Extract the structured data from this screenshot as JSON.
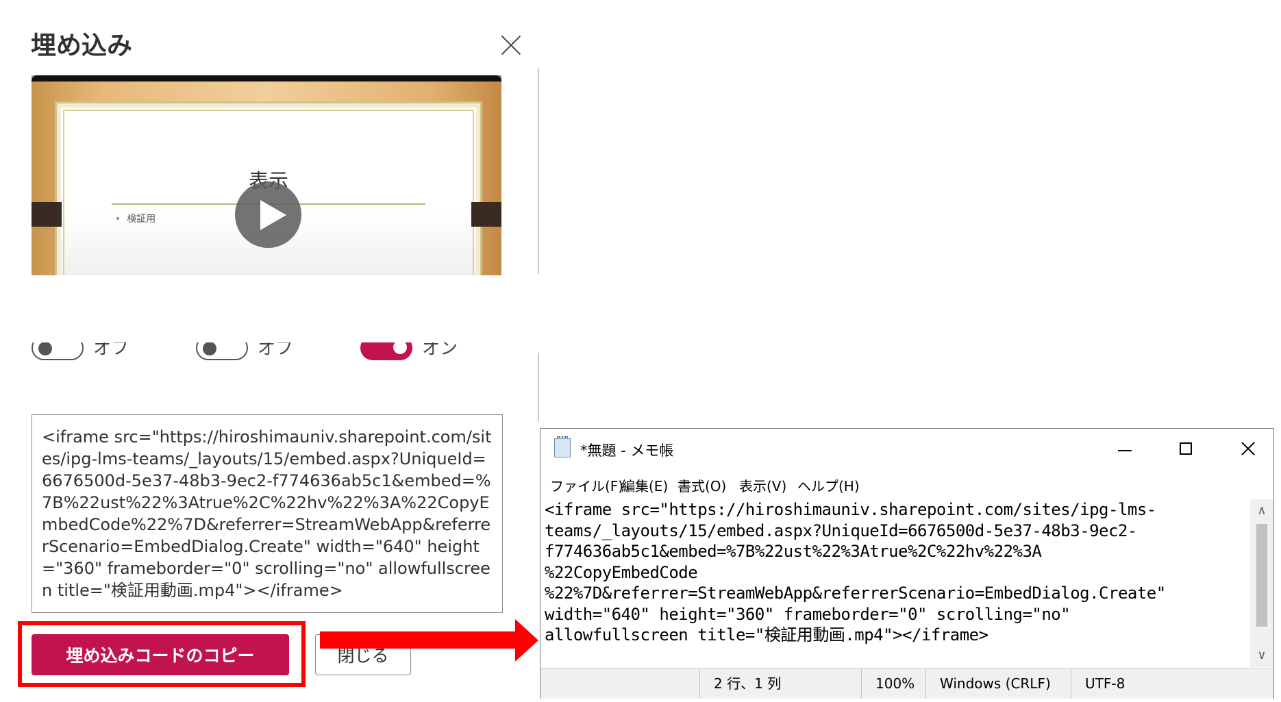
{
  "dialog": {
    "title": "埋め込み",
    "video": {
      "slide_title": "表示",
      "slide_bullet": "検証用"
    },
    "toggles": [
      {
        "state": "off",
        "label": "オフ"
      },
      {
        "state": "off",
        "label": "オフ"
      },
      {
        "state": "on",
        "label": "オン"
      }
    ],
    "embed_code": "<iframe src=\"https://hiroshimauniv.sharepoint.com/sites/ipg-lms-teams/_layouts/15/embed.aspx?UniqueId=6676500d-5e37-48b3-9ec2-f774636ab5c1&embed=%7B%22ust%22%3Atrue%2C%22hv%22%3A%22CopyEmbedCode%22%7D&referrer=StreamWebApp&referrerScenario=EmbedDialog.Create\" width=\"640\" height=\"360\" frameborder=\"0\" scrolling=\"no\" allowfullscreen title=\"検証用動画.mp4\"></iframe>",
    "copy_button": "埋め込みコードのコピー",
    "close_button": "閉じる",
    "accent_color": "#c2134d",
    "highlight_color": "#ff0000"
  },
  "notepad": {
    "title": "*無題 - メモ帳",
    "menu": [
      "ファイル(F)",
      "編集(E)",
      "書式(O)",
      "表示(V)",
      "ヘルプ(H)"
    ],
    "content": "<iframe src=\"https://hiroshimauniv.sharepoint.com/sites/ipg-lms-\nteams/_layouts/15/embed.aspx?UniqueId=6676500d-5e37-48b3-9ec2-\nf774636ab5c1&embed=%7B%22ust%22%3Atrue%2C%22hv%22%3A\n%22CopyEmbedCode\n%22%7D&referrer=StreamWebApp&referrerScenario=EmbedDialog.Create\"\nwidth=\"640\" height=\"360\" frameborder=\"0\" scrolling=\"no\"\nallowfullscreen title=\"検証用動画.mp4\"></iframe>",
    "status": {
      "position": "2 行、1 列",
      "zoom": "100%",
      "line_ending": "Windows (CRLF)",
      "encoding": "UTF-8"
    }
  }
}
